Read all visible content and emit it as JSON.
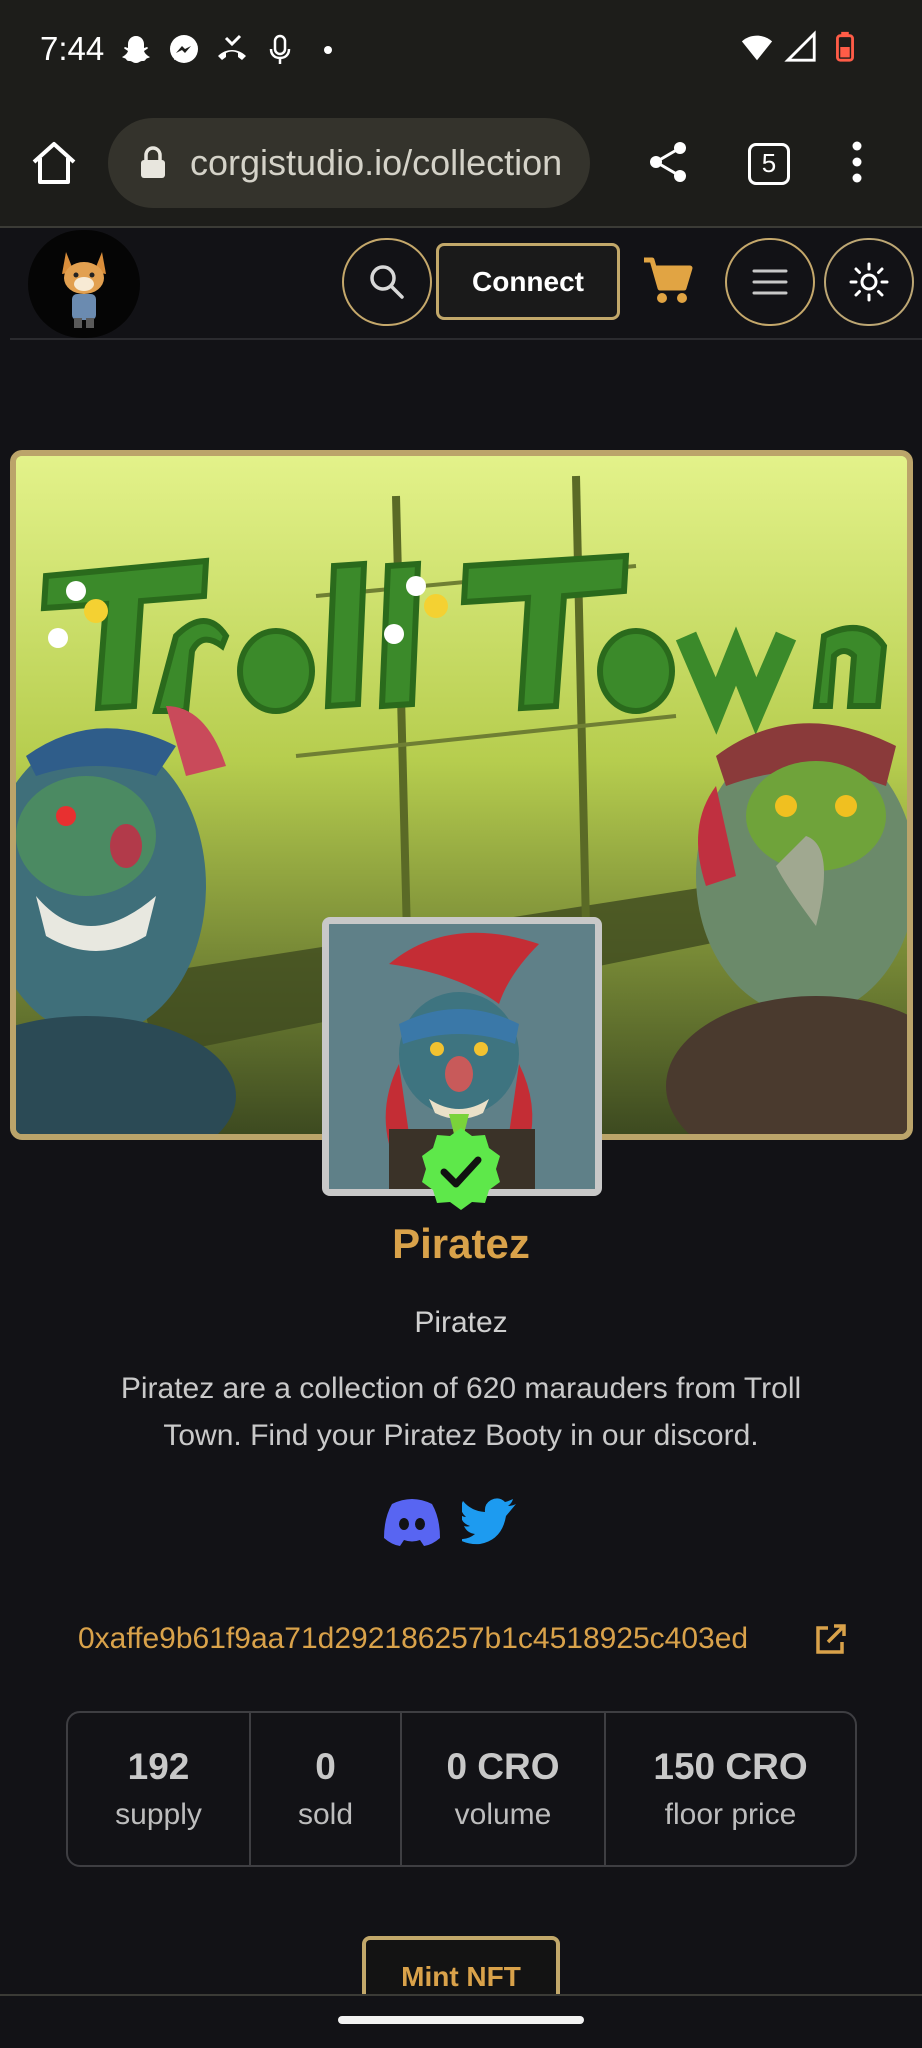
{
  "status_bar": {
    "time": "7:44",
    "left_icons": [
      "snapchat-icon",
      "messenger-icon",
      "missed-call-icon",
      "microphone-icon",
      "dot-icon"
    ],
    "right_icons": [
      "wifi-icon",
      "signal-icon",
      "battery-icon"
    ]
  },
  "browser": {
    "url": "corgistudio.io/collection",
    "tab_count": "5"
  },
  "header": {
    "connect_label": "Connect"
  },
  "banner": {
    "title_art": "Troll Town"
  },
  "collection": {
    "title": "Piratez",
    "subtitle": "Piratez",
    "description": "Piratez are a collection of 620 marauders from Troll Town. Find your Piratez Booty in our discord.",
    "contract": "0xaffe9b61f9aa71d292186257b1c4518925c403ed"
  },
  "stats": [
    {
      "value": "192",
      "label": "supply"
    },
    {
      "value": "0",
      "label": "sold"
    },
    {
      "value": "0 CRO",
      "label": "volume"
    },
    {
      "value": "150 CRO",
      "label": "floor price"
    }
  ],
  "mint_label": "Mint NFT",
  "colors": {
    "accent_gold": "#d9a24a",
    "border_gold": "#c2a86a",
    "background": "#121216",
    "verified_green": "#5ee84a",
    "discord_purple": "#5865f2",
    "twitter_blue": "#1d9bf0"
  }
}
